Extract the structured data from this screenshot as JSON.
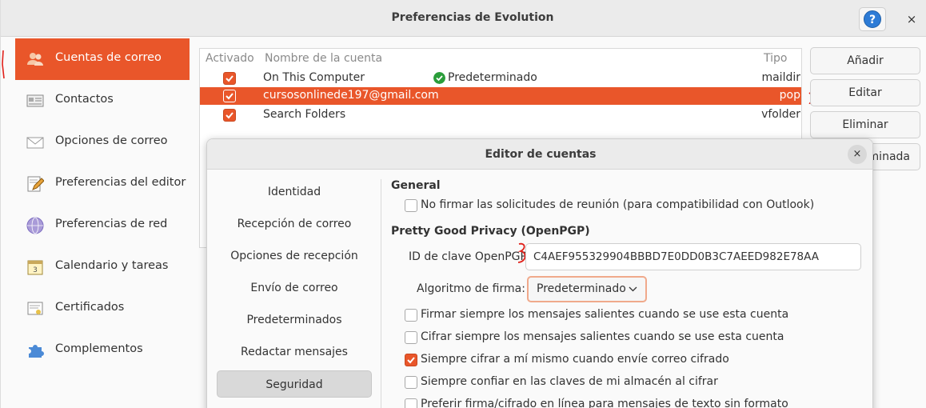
{
  "window": {
    "title": "Preferencias de Evolution",
    "help_label": "?",
    "close_label": "×"
  },
  "sidebar": {
    "items": [
      {
        "label": "Cuentas de correo",
        "icon": "people-icon"
      },
      {
        "label": "Contactos",
        "icon": "address-card-icon"
      },
      {
        "label": "Opciones de correo",
        "icon": "envelope-icon"
      },
      {
        "label": "Preferencias del editor",
        "icon": "edit-pencil-icon"
      },
      {
        "label": "Preferencias de red",
        "icon": "network-globe-icon"
      },
      {
        "label": "Calendario y tareas",
        "icon": "calendar-icon"
      },
      {
        "label": "Certificados",
        "icon": "certificate-icon"
      },
      {
        "label": "Complementos",
        "icon": "puzzle-piece-icon"
      }
    ]
  },
  "accounts": {
    "columns": {
      "enabled": "Activado",
      "name": "Nombre de la cuenta",
      "type": "Tipo"
    },
    "rows": [
      {
        "name": "On This Computer",
        "default": "Predeterminado",
        "type": "maildir",
        "enabled": true
      },
      {
        "name": "cursosonlinede197@gmail.com",
        "default": "",
        "type": "pop",
        "enabled": true
      },
      {
        "name": "Search Folders",
        "default": "",
        "type": "vfolder",
        "enabled": true
      }
    ]
  },
  "account_buttons": {
    "add": "Añadir",
    "edit": "Editar",
    "delete": "Eliminar",
    "default_partial": "minada"
  },
  "dialog": {
    "title": "Editor de cuentas",
    "close_label": "×",
    "nav": [
      "Identidad",
      "Recepción de correo",
      "Opciones de recepción",
      "Envío de correo",
      "Predeterminados",
      "Redactar mensajes",
      "Seguridad"
    ],
    "general_title": "General",
    "no_sign_meetings": "No firmar las solicitudes de reunión (para compatibilidad con Outlook)",
    "pgp_title": "Pretty Good Privacy (OpenPGP)",
    "key_id_label": "ID de clave OpenPGP:",
    "key_id_value": "C4AEF955329904BBBD7E0DD0B3C7AEED982E78AA",
    "algo_label": "Algoritmo de firma:",
    "algo_value": "Predeterminado",
    "options": [
      {
        "label": "Firmar siempre los mensajes salientes cuando se use esta cuenta",
        "checked": false
      },
      {
        "label": "Cifrar siempre los mensajes salientes cuando se use esta cuenta",
        "checked": false
      },
      {
        "label": "Siempre cifrar a mí mismo cuando envíe correo cifrado",
        "checked": true
      },
      {
        "label": "Siempre confiar en las claves de mi almacén al cifrar",
        "checked": false
      },
      {
        "label": "Preferir firma/cifrado en línea para mensajes de texto sin formato",
        "checked": false
      }
    ]
  },
  "colors": {
    "accent": "#e9562a",
    "annotation": "#e0201a"
  }
}
